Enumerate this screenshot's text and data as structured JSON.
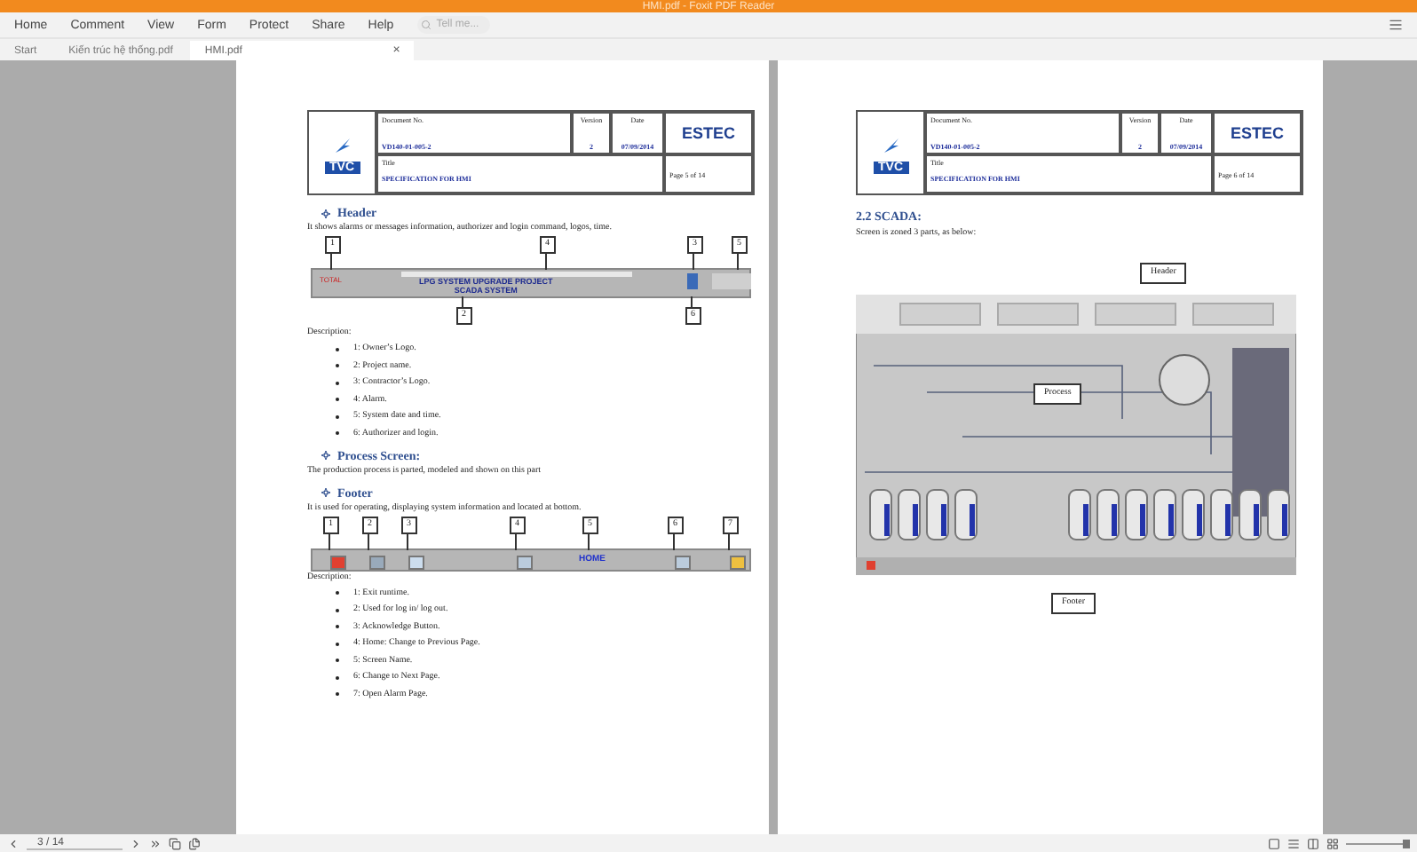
{
  "window": {
    "title": "HMI.pdf - Foxit PDF Reader"
  },
  "menu": [
    {
      "label": "Home",
      "selected": false
    },
    {
      "label": "Comment",
      "selected": false
    },
    {
      "label": "View",
      "selected": false
    },
    {
      "label": "Form",
      "selected": false
    },
    {
      "label": "Protect",
      "selected": false
    },
    {
      "label": "Share",
      "selected": false
    },
    {
      "label": "Help",
      "selected": false
    }
  ],
  "search": {
    "placeholder": "Tell me..."
  },
  "tabs": [
    {
      "label": "Start",
      "selected": false
    },
    {
      "label": "Kiến trúc hệ thống.pdf",
      "selected": false
    },
    {
      "label": "HMI.pdf",
      "selected": true,
      "close": "×"
    }
  ],
  "pages": [
    {
      "doc_header": {
        "logo_left": "TVC",
        "doc_no_label": "Document No.",
        "doc_no": "VD140-01-005-2",
        "version_label": "Version",
        "version": "2",
        "date_label": "Date",
        "date": "07/09/2014",
        "title_label": "Title",
        "title": "SPECIFICATION FOR HMI",
        "logo_right": "ESTEC",
        "page": "Page 5 of 14"
      },
      "blocks": [
        {
          "kind": "heading",
          "text": "Header"
        },
        {
          "kind": "paragraph",
          "text": "It shows alarms or messages information, authorizer and login command, logos, time."
        },
        {
          "kind": "header_diagram",
          "callouts": [
            "1",
            "4",
            "3",
            "5",
            "2",
            "6"
          ],
          "owner_logo": "TOTAL",
          "project": "LPG SYSTEM UPGRADE PROJECT",
          "system": "SCADA SYSTEM"
        },
        {
          "kind": "paragraph",
          "text": "Description:"
        },
        {
          "kind": "list",
          "items": [
            "1: Owner’s Logo.",
            "2: Project name.",
            "3: Contractor’s Logo.",
            "4: Alarm.",
            "5: System date and time.",
            "6: Authorizer and login."
          ]
        },
        {
          "kind": "heading",
          "text": "Process Screen:"
        },
        {
          "kind": "paragraph",
          "text": "The production process is parted, modeled and shown on this part"
        },
        {
          "kind": "heading",
          "text": "Footer"
        },
        {
          "kind": "paragraph",
          "text": "It is used for operating, displaying system information and located at bottom."
        },
        {
          "kind": "footer_diagram",
          "callouts": [
            "1",
            "2",
            "3",
            "4",
            "5",
            "6",
            "7"
          ],
          "screen_name": "HOME"
        },
        {
          "kind": "paragraph",
          "text": "Description:"
        },
        {
          "kind": "list",
          "items": [
            "1: Exit runtime.",
            "2: Used for log in/ log out.",
            "3: Acknowledge Button.",
            "4: Home: Change to Previous Page.",
            "5: Screen Name.",
            "6: Change to Next Page.",
            "7: Open Alarm Page."
          ]
        }
      ]
    },
    {
      "doc_header": {
        "logo_left": "TVC",
        "doc_no_label": "Document No.",
        "doc_no": "VD140-01-005-2",
        "version_label": "Version",
        "version": "2",
        "date_label": "Date",
        "date": "07/09/2014",
        "title_label": "Title",
        "title": "SPECIFICATION FOR HMI",
        "logo_right": "ESTEC",
        "page": "Page 6 of 14"
      },
      "blocks": [
        {
          "kind": "section",
          "text": "2.2   SCADA:"
        },
        {
          "kind": "paragraph",
          "text": "Screen is zoned 3 parts, as below:"
        },
        {
          "kind": "scada_figure",
          "callouts": [
            "Header",
            "Process",
            "Footer"
          ]
        }
      ]
    }
  ],
  "status_bar": {
    "page": "3 / 14",
    "zoom": {
      "level": 0.95
    }
  }
}
